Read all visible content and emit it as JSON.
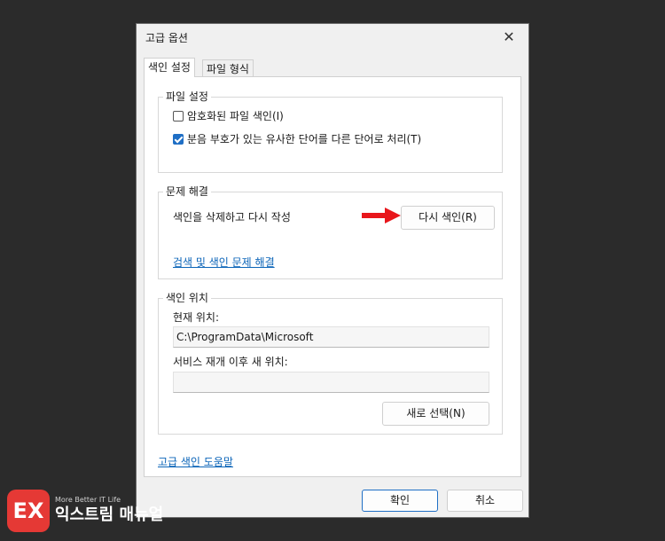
{
  "dialog": {
    "title": "고급 옵션",
    "close_glyph": "✕",
    "tabs": [
      {
        "label": "색인 설정",
        "active": true
      },
      {
        "label": "파일 형식",
        "active": false
      }
    ]
  },
  "file_settings": {
    "label": "파일 설정",
    "checkboxes": [
      {
        "label": "암호화된 파일 색인(I)",
        "checked": false
      },
      {
        "label": "분음 부호가 있는 유사한 단어를 다른 단어로 처리(T)",
        "checked": true
      }
    ]
  },
  "troubleshoot": {
    "label": "문제 해결",
    "description": "색인을 삭제하고 다시 작성",
    "rebuild_button": "다시 색인(R)",
    "link": "검색 및 색인 문제 해결"
  },
  "index_location": {
    "label": "색인 위치",
    "current_label": "현재 위치:",
    "current_value": "C:\\ProgramData\\Microsoft",
    "new_label": "서비스 재개 이후 새 위치:",
    "new_value": "",
    "select_button": "새로 선택(N)"
  },
  "help_link": "고급 색인 도움말",
  "footer": {
    "ok_button": "확인",
    "cancel_button": "취소"
  },
  "accent_color": "#1f6fc5",
  "annotation_arrow_color": "#e8161b",
  "watermark": {
    "tagline": "More Better IT Life",
    "brand": "익스트림 매뉴얼"
  }
}
